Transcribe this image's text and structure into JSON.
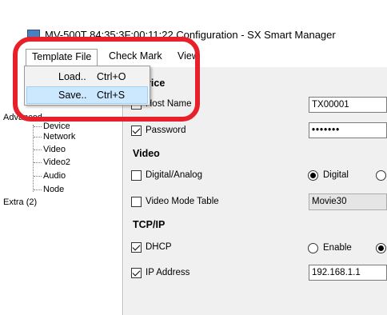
{
  "window": {
    "title": "MV-500T 84:35:3F:00:11:22 Configuration - SX Smart Manager"
  },
  "menubar": {
    "items": [
      {
        "label": "Template File"
      },
      {
        "label": "Check Mark"
      },
      {
        "label": "View"
      }
    ]
  },
  "dropdown": {
    "items": [
      {
        "label": "Load..",
        "shortcut": "Ctrl+O"
      },
      {
        "label": "Save..",
        "shortcut": "Ctrl+S"
      }
    ]
  },
  "tree": {
    "items": [
      {
        "label": "Advanced"
      },
      {
        "label": "Device"
      },
      {
        "label": "Network"
      },
      {
        "label": "Video"
      },
      {
        "label": "Video2"
      },
      {
        "label": "Audio"
      },
      {
        "label": "Node"
      },
      {
        "label": "Extra (2)"
      }
    ]
  },
  "device": {
    "section_title": "Device",
    "host_name_label": "Host Name",
    "host_name_value": "TX00001",
    "host_name_checked": false,
    "password_label": "Password",
    "password_value": "•••••••",
    "password_checked": true
  },
  "video": {
    "section_title": "Video",
    "digital_analog_label": "Digital/Analog",
    "digital_analog_checked": false,
    "digital_option": "Digital",
    "digital_selected": true,
    "video_mode_label": "Video Mode Table",
    "video_mode_checked": false,
    "video_mode_value": "Movie30"
  },
  "tcpip": {
    "section_title": "TCP/IP",
    "dhcp_label": "DHCP",
    "dhcp_checked": true,
    "enable_option": "Enable",
    "enable_selected": false,
    "ip_label": "IP Address",
    "ip_checked": true,
    "ip_value": "192.168.1.1"
  },
  "colors": {
    "annotation_ring": "#e8202a",
    "menu_hover": "#cce8ff",
    "panel_bg": "#f0f0f0"
  }
}
